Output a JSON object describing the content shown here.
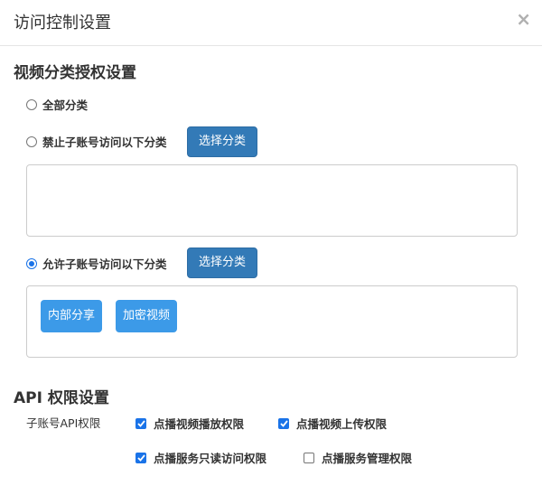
{
  "dialog": {
    "title": "访问控制设置",
    "close_symbol": "×"
  },
  "video_section": {
    "title": "视频分类授权设置",
    "options": [
      {
        "label": "全部分类",
        "checked": false
      },
      {
        "label": "禁止子账号访问以下分类",
        "checked": false,
        "button": "选择分类",
        "tags": []
      },
      {
        "label": "允许子账号访问以下分类",
        "checked": true,
        "button": "选择分类",
        "tags": [
          "内部分享",
          "加密视频"
        ]
      }
    ]
  },
  "api_section": {
    "title": "API 权限设置",
    "row_label": "子账号API权限",
    "permissions": [
      {
        "label": "点播视频播放权限",
        "checked": true
      },
      {
        "label": "点播视频上传权限",
        "checked": true
      },
      {
        "label": "点播服务只读访问权限",
        "checked": true
      },
      {
        "label": "点播服务管理权限",
        "checked": false
      }
    ]
  },
  "colors": {
    "primary_button": "#337ab7",
    "tag": "#3c9ae8",
    "checkbox": "#1a73e8"
  }
}
